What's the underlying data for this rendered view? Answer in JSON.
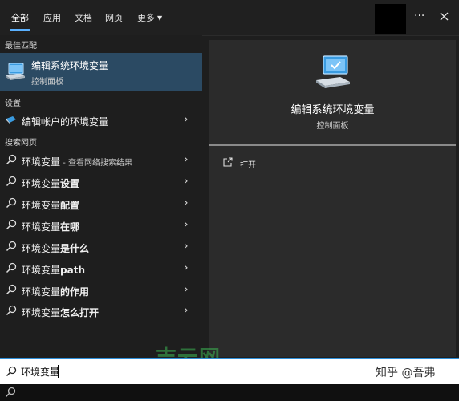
{
  "tabs": [
    {
      "label": "全部",
      "active": true
    },
    {
      "label": "应用",
      "active": false
    },
    {
      "label": "文档",
      "active": false
    },
    {
      "label": "网页",
      "active": false
    },
    {
      "label": "更多",
      "active": false
    }
  ],
  "topbar": {
    "more_icon": "ellipsis-icon",
    "close_icon": "close-icon"
  },
  "best_match": {
    "section_label": "最佳匹配",
    "title": "编辑系统环境变量",
    "subtitle": "控制面板",
    "icon": "computer-icon"
  },
  "settings": {
    "section_label": "设置",
    "items": [
      {
        "label": "编辑帐户的环境变量",
        "icon": "settings-icon"
      }
    ]
  },
  "web_search": {
    "section_label": "搜索网页",
    "items": [
      {
        "normal": "环境变量",
        "bold": "",
        "suffix": " - 查看网络搜索结果"
      },
      {
        "normal": "环境变量",
        "bold": "设置",
        "suffix": ""
      },
      {
        "normal": "环境变量",
        "bold": "配置",
        "suffix": ""
      },
      {
        "normal": "环境变量",
        "bold": "在哪",
        "suffix": ""
      },
      {
        "normal": "环境变量",
        "bold": "是什么",
        "suffix": ""
      },
      {
        "normal": "环境变量",
        "bold": "path",
        "suffix": ""
      },
      {
        "normal": "环境变量",
        "bold": "的作用",
        "suffix": ""
      },
      {
        "normal": "环境变量",
        "bold": "怎么打开",
        "suffix": ""
      }
    ]
  },
  "detail": {
    "title": "编辑系统环境变量",
    "subtitle": "控制面板",
    "actions": [
      {
        "label": "打开",
        "icon": "open-icon"
      }
    ]
  },
  "search": {
    "value": "环境变量"
  },
  "watermark": "吉云网",
  "credit": "知乎 @吾弗",
  "colors": {
    "accent": "#2f8fd8",
    "selected_bg": "#2b4a63",
    "panel_bg": "#1e1e1e",
    "detail_bg": "#2b2b2b"
  }
}
